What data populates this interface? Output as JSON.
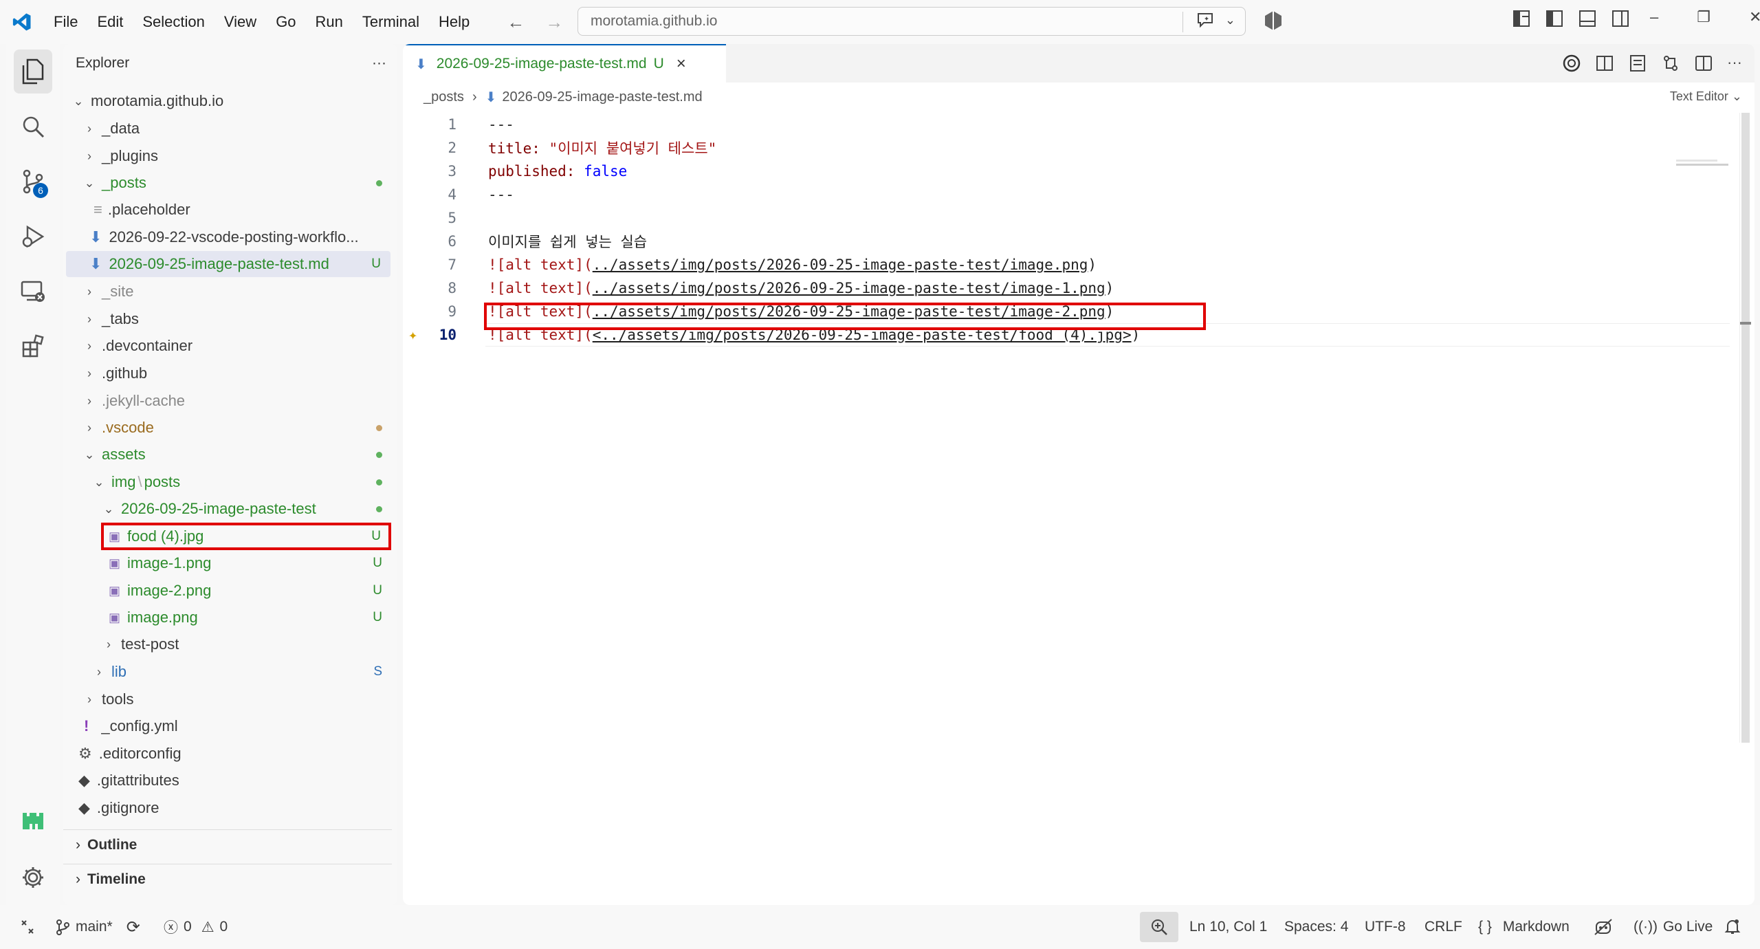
{
  "titlebar": {
    "menu": [
      "File",
      "Edit",
      "Selection",
      "View",
      "Go",
      "Run",
      "Terminal",
      "Help"
    ],
    "search_text": "morotamia.github.io"
  },
  "activity_bar": {
    "source_control_badge": "6"
  },
  "explorer": {
    "title": "Explorer",
    "more": "···",
    "root": "morotamia.github.io",
    "items": [
      {
        "label": "_data",
        "status": ""
      },
      {
        "label": "_plugins",
        "status": ""
      },
      {
        "label": "_posts",
        "status": ""
      },
      {
        "label": ".placeholder",
        "status": ""
      },
      {
        "label": "2026-09-22-vscode-posting-workflo...",
        "status": ""
      },
      {
        "label": "2026-09-25-image-paste-test.md",
        "status": "U"
      },
      {
        "label": "_site",
        "status": ""
      },
      {
        "label": "_tabs",
        "status": ""
      },
      {
        "label": ".devcontainer",
        "status": ""
      },
      {
        "label": ".github",
        "status": ""
      },
      {
        "label": ".jekyll-cache",
        "status": ""
      },
      {
        "label": ".vscode",
        "status": ""
      },
      {
        "label": "assets",
        "status": ""
      },
      {
        "label_a": "img",
        "label_sep": "\\",
        "label_b": "posts",
        "status": ""
      },
      {
        "label": "2026-09-25-image-paste-test",
        "status": ""
      },
      {
        "label": "food (4).jpg",
        "status": "U"
      },
      {
        "label": "image-1.png",
        "status": "U"
      },
      {
        "label": "image-2.png",
        "status": "U"
      },
      {
        "label": "image.png",
        "status": "U"
      },
      {
        "label": "test-post",
        "status": ""
      },
      {
        "label": "lib",
        "status": "S"
      },
      {
        "label": "tools",
        "status": ""
      },
      {
        "label": "_config.yml",
        "status": ""
      },
      {
        "label": ".editorconfig",
        "status": ""
      },
      {
        "label": ".gitattributes",
        "status": ""
      },
      {
        "label": ".gitignore",
        "status": ""
      }
    ],
    "outline": "Outline",
    "timeline": "Timeline"
  },
  "editor": {
    "tab_label": "2026-09-25-image-paste-test.md",
    "tab_status": "U",
    "breadcrumb_folder": "_posts",
    "breadcrumb_file": "2026-09-25-image-paste-test.md",
    "text_editor_label": "Text Editor",
    "line_numbers": [
      "1",
      "2",
      "3",
      "4",
      "5",
      "6",
      "7",
      "8",
      "9",
      "10"
    ],
    "lines": {
      "l1": "---",
      "l2_key": "title:",
      "l2_val": "\"이미지 붙여넣기 테스트\"",
      "l3_key": "published:",
      "l3_val": "false",
      "l4": "---",
      "l6": "이미지를 쉽게 넣는 실습",
      "l7_a": "![alt text](",
      "l7_url": "../assets/img/posts/2026-09-25-image-paste-test/image.png",
      "l7_b": ")",
      "l8_a": "![alt text](",
      "l8_url": "../assets/img/posts/2026-09-25-image-paste-test/image-1.png",
      "l8_b": ")",
      "l9_a": "![alt text](",
      "l9_url": "../assets/img/posts/2026-09-25-image-paste-test/image-2.png",
      "l9_b": ")",
      "l10_a": "![alt text](",
      "l10_url": "<../assets/img/posts/2026-09-25-image-paste-test/food (4).jpg>",
      "l10_b": ")"
    }
  },
  "statusbar": {
    "branch": "main*",
    "errors": "0",
    "warnings": "0",
    "position": "Ln 10, Col 1",
    "spaces": "Spaces: 4",
    "encoding": "UTF-8",
    "eol": "CRLF",
    "language_icon": "{ }",
    "language": "Markdown",
    "golive": "Go Live"
  },
  "colors": {
    "accent": "#005fb8",
    "untracked_green": "#2c8b2c",
    "highlight_red": "#e00000"
  }
}
